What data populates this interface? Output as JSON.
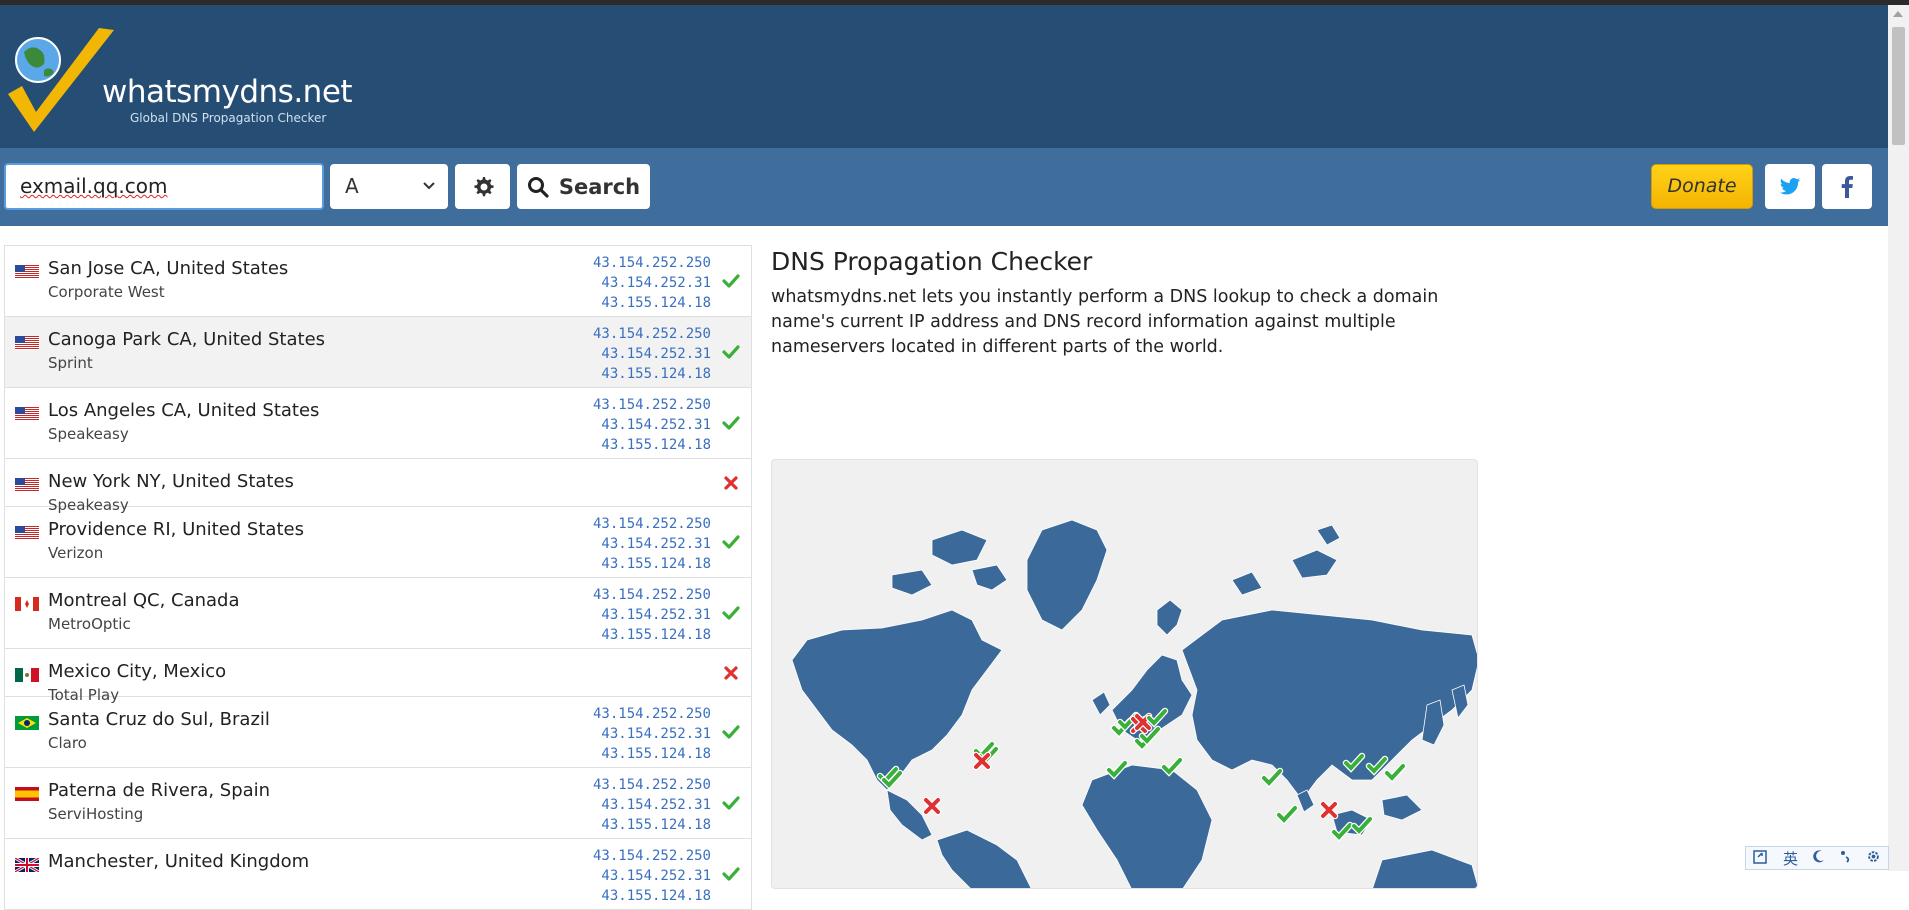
{
  "logo": {
    "name": "whatsmydns.net",
    "tagline": "Global DNS Propagation Checker"
  },
  "search": {
    "domain_value": "exmail.qq.com",
    "record_type": "A",
    "search_label": "Search"
  },
  "header_actions": {
    "donate_label": "Donate"
  },
  "results": [
    {
      "flag": "us",
      "location": "San Jose CA, United States",
      "provider": "Corporate West",
      "ips": [
        "43.154.252.250",
        "43.154.252.31",
        "43.155.124.18"
      ],
      "status": "ok"
    },
    {
      "flag": "us",
      "location": "Canoga Park CA, United States",
      "provider": "Sprint",
      "ips": [
        "43.154.252.250",
        "43.154.252.31",
        "43.155.124.18"
      ],
      "status": "ok"
    },
    {
      "flag": "us",
      "location": "Los Angeles CA, United States",
      "provider": "Speakeasy",
      "ips": [
        "43.154.252.250",
        "43.154.252.31",
        "43.155.124.18"
      ],
      "status": "ok"
    },
    {
      "flag": "us",
      "location": "New York NY, United States",
      "provider": "Speakeasy",
      "ips": [],
      "status": "fail"
    },
    {
      "flag": "us",
      "location": "Providence RI, United States",
      "provider": "Verizon",
      "ips": [
        "43.154.252.250",
        "43.154.252.31",
        "43.155.124.18"
      ],
      "status": "ok"
    },
    {
      "flag": "ca",
      "location": "Montreal QC, Canada",
      "provider": "MetroOptic",
      "ips": [
        "43.154.252.250",
        "43.154.252.31",
        "43.155.124.18"
      ],
      "status": "ok"
    },
    {
      "flag": "mx",
      "location": "Mexico City, Mexico",
      "provider": "Total Play",
      "ips": [],
      "status": "fail"
    },
    {
      "flag": "br",
      "location": "Santa Cruz do Sul, Brazil",
      "provider": "Claro",
      "ips": [
        "43.154.252.250",
        "43.154.252.31",
        "43.155.124.18"
      ],
      "status": "ok"
    },
    {
      "flag": "es",
      "location": "Paterna de Rivera, Spain",
      "provider": "ServiHosting",
      "ips": [
        "43.154.252.250",
        "43.154.252.31",
        "43.155.124.18"
      ],
      "status": "ok"
    },
    {
      "flag": "gb",
      "location": "Manchester, United Kingdom",
      "provider": "",
      "ips": [
        "43.154.252.250",
        "43.154.252.31",
        "43.155.124.18"
      ],
      "status": "ok"
    }
  ],
  "info": {
    "title": "DNS Propagation Checker",
    "description": "whatsmydns.net lets you instantly perform a DNS lookup to check a domain name's current IP address and DNS record information against multiple nameservers located in different parts of the world."
  },
  "map_markers": [
    {
      "name": "check",
      "status": "ok"
    },
    {
      "name": "cross",
      "status": "fail"
    }
  ],
  "ime_bar": {
    "lang": "英"
  },
  "colors": {
    "header": "#264d73",
    "toolbar": "#3f6e9c",
    "ok": "#3ab03a",
    "fail": "#e03131",
    "ip": "#3a6fc0",
    "map_land": "#3b6a9a"
  },
  "icons": [
    "logo-icon",
    "gear-icon",
    "search-icon",
    "twitter-icon",
    "facebook-icon",
    "check-icon",
    "cross-icon",
    "chevron-down-icon"
  ]
}
